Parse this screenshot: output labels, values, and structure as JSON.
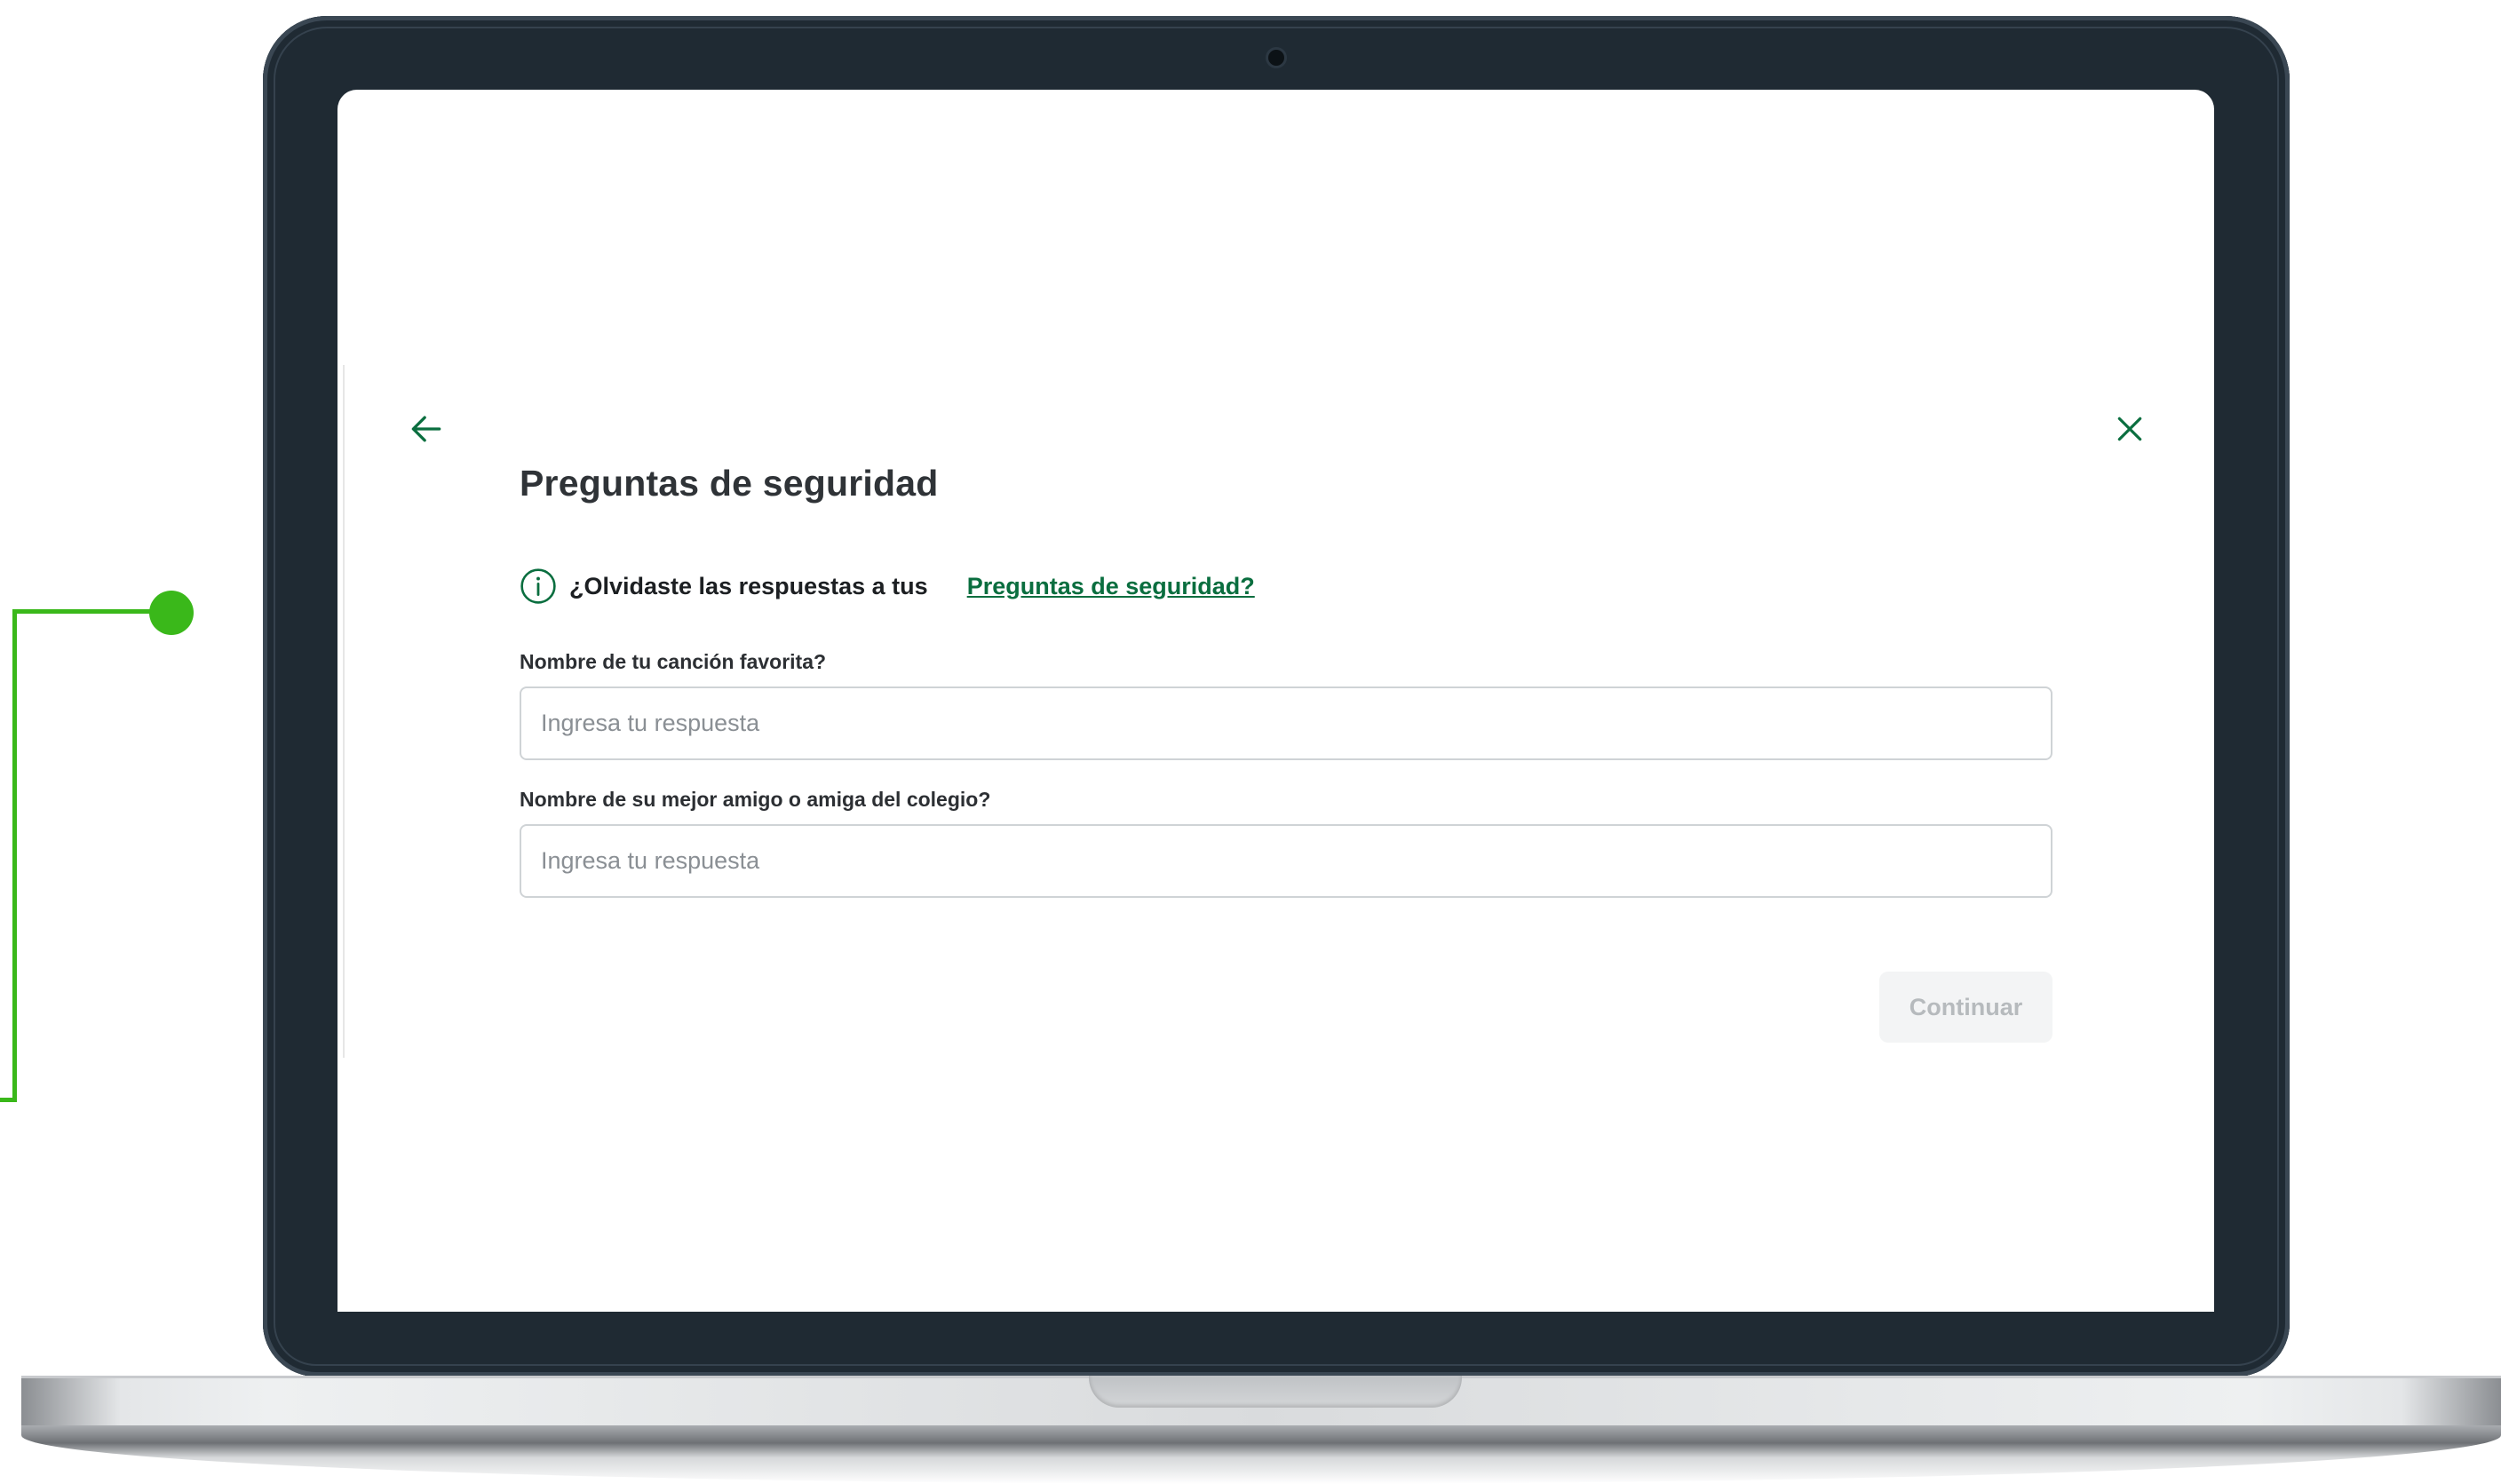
{
  "colors": {
    "brand_green": "#0a6e3f",
    "connector_green": "#3ab81a",
    "laptop_bezel": "#1f2a33",
    "disabled_button_bg": "#f3f4f5",
    "disabled_button_text": "#b6babd"
  },
  "icons": {
    "back": "arrow-left-icon",
    "close": "close-icon",
    "info": "info-circle-icon"
  },
  "page": {
    "title": "Preguntas de seguridad"
  },
  "info_banner": {
    "text": "¿Olvidaste las respuestas a tus",
    "link": "Preguntas de seguridad?"
  },
  "form": {
    "fields": [
      {
        "label": "Nombre de tu canción favorita?",
        "value": "",
        "placeholder": "Ingresa tu respuesta"
      },
      {
        "label": "Nombre de su mejor amigo o amiga del colegio?",
        "value": "",
        "placeholder": "Ingresa tu respuesta"
      }
    ],
    "submit_label": "Continuar",
    "submit_enabled": false
  }
}
